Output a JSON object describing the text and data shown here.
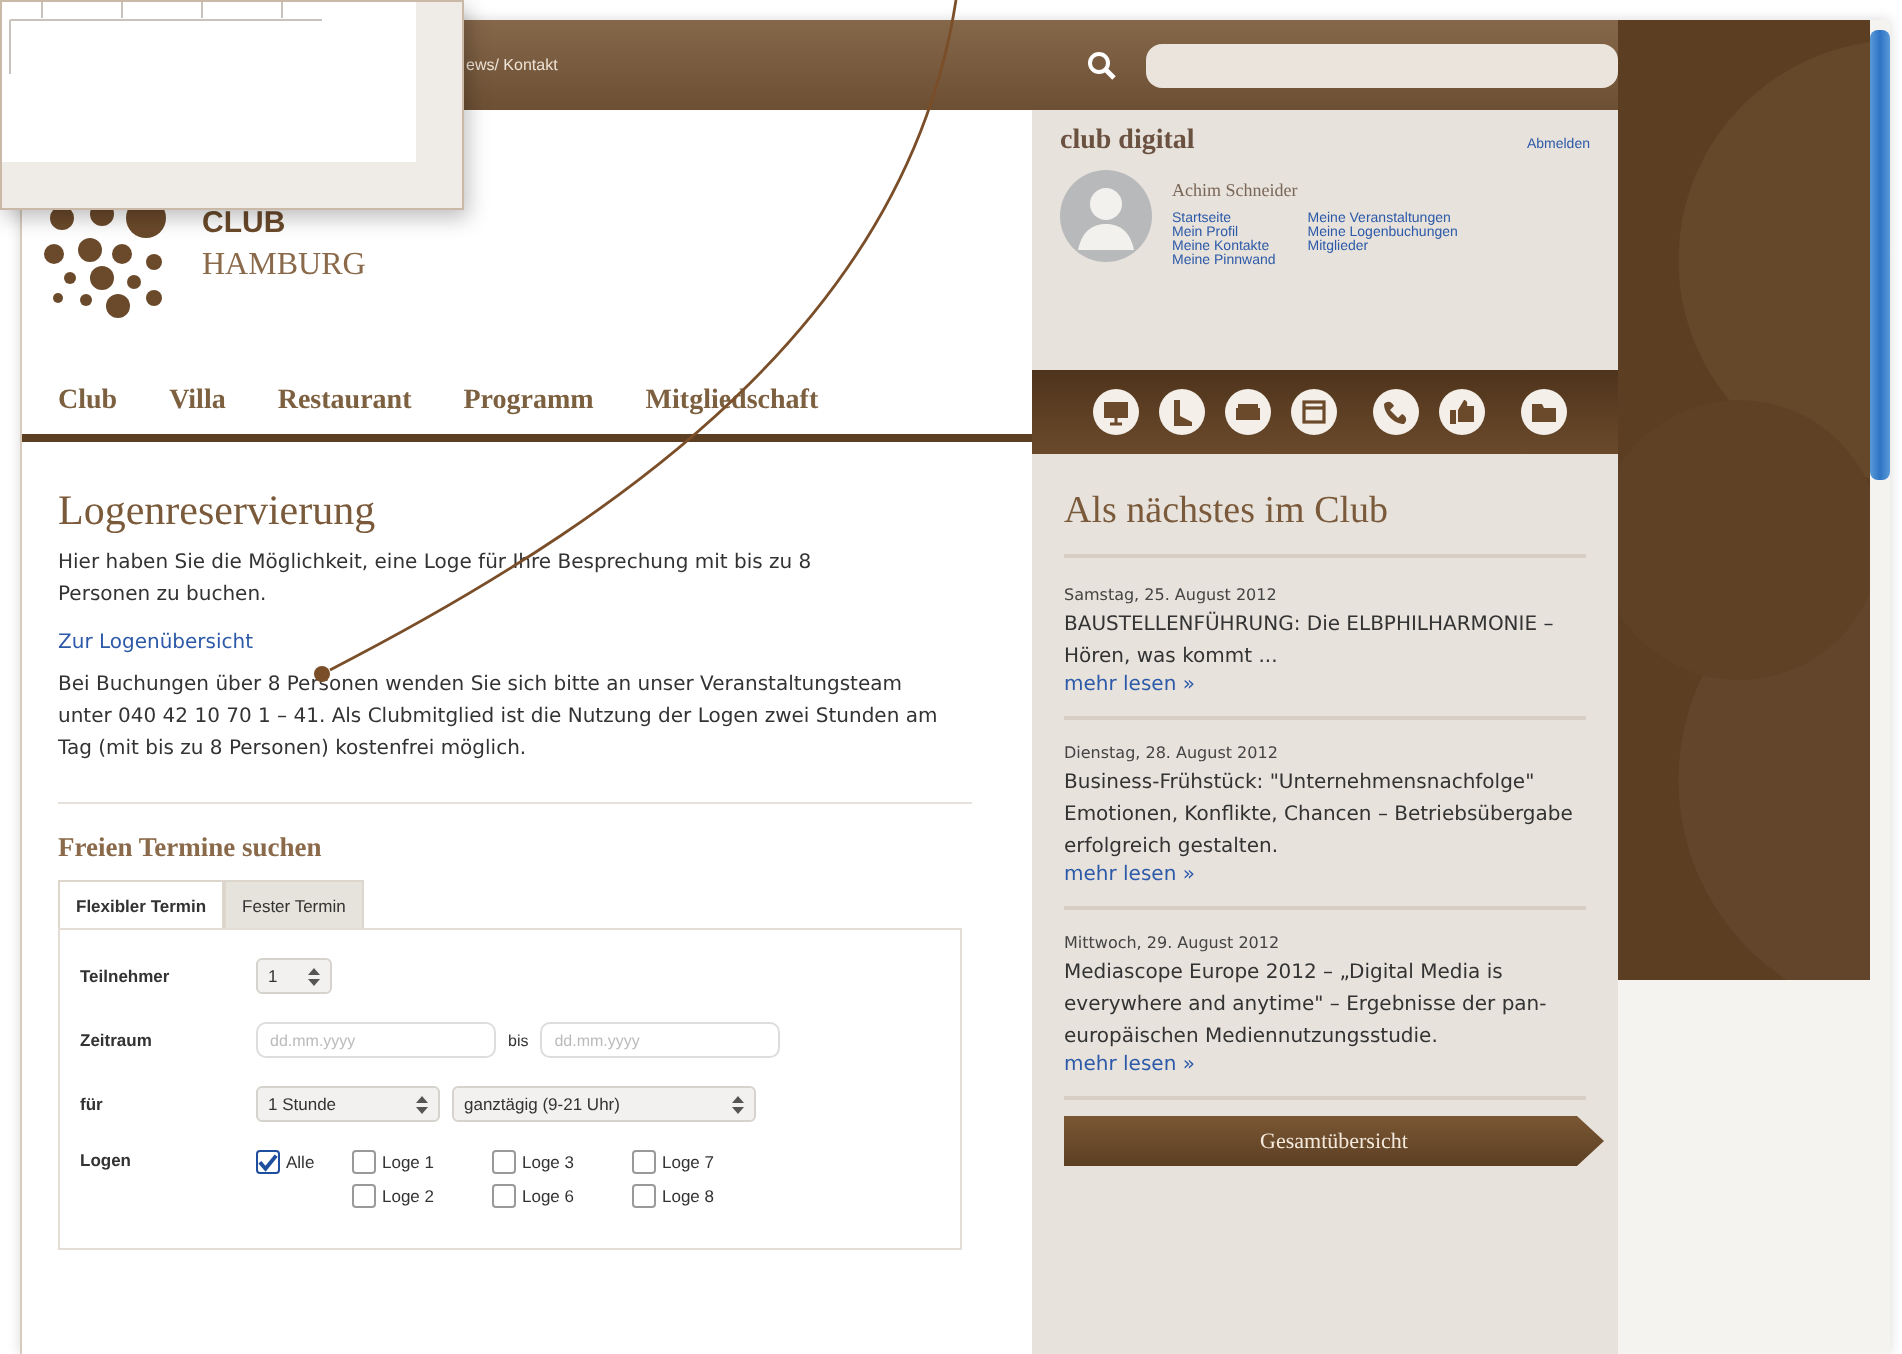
{
  "top_bar": {
    "breadcrumb": "ews/ Kontakt"
  },
  "logo": {
    "line_1": "CLUB",
    "line_2": "HAMBURG"
  },
  "nav": [
    "Club",
    "Villa",
    "Restaurant",
    "Programm",
    "Mitgliedschaft"
  ],
  "main": {
    "title": "Logenreservierung",
    "intro": "Hier haben Sie die Möglichkeit, eine Loge für Ihre Besprechung mit bis zu 8 Personen zu buchen.",
    "link": "Zur Logenübersicht",
    "body": "Bei Buchungen über 8 Personen wenden Sie sich bitte an unser Veranstaltungsteam unter 040 42 10 70 1 – 41. Als Clubmitglied ist die Nutzung der Logen zwei Stunden am Tag (mit bis zu 8 Personen) kostenfrei möglich.",
    "search_title": "Freien Termine suchen",
    "tabs": [
      {
        "label": "Flexibler Termin",
        "selected": true
      },
      {
        "label": "Fester Termin",
        "selected": false
      }
    ],
    "form": {
      "participants": {
        "label": "Teilnehmer",
        "value": "1"
      },
      "period": {
        "label": "Zeitraum",
        "from_placeholder": "dd.mm.yyyy",
        "separator": "bis",
        "to_placeholder": "dd.mm.yyyy"
      },
      "duration": {
        "label": "für",
        "value": "1 Stunde",
        "time_value": "ganztägig (9-21 Uhr)"
      },
      "boxes": {
        "label": "Logen",
        "options": [
          {
            "label": "Alle",
            "checked": true
          },
          {
            "label": "Loge 1",
            "checked": false
          },
          {
            "label": "Loge 3",
            "checked": false
          },
          {
            "label": "Loge 7",
            "checked": false
          },
          {
            "label": "Loge 2",
            "checked": false
          },
          {
            "label": "Loge 6",
            "checked": false
          },
          {
            "label": "Loge 8",
            "checked": false
          }
        ]
      }
    }
  },
  "club_digital": {
    "title": "club digital",
    "logout": "Abmelden",
    "user": "Achim Schneider",
    "links": [
      "Startseite",
      "Mein Profil",
      "Meine Kontakte",
      "Meine Pinnwand",
      "Meine Veranstaltungen",
      "Meine Logenbuchungen",
      "Mitglieder"
    ]
  },
  "events": {
    "title": "Als nächstes im Club",
    "items": [
      {
        "date": "Samstag, 25. August 2012",
        "text": "BAUSTELLENFÜHRUNG: Die ELBPHILHARMONIE – Hören, was kommt ...",
        "more": "mehr lesen »"
      },
      {
        "date": "Dienstag, 28. August 2012",
        "text": "Business-Frühstück: \"Unternehmensnachfolge\" Emotionen, Konflikte, Chancen – Betriebsübergabe erfolgreich gestalten.",
        "more": "mehr lesen »"
      },
      {
        "date": "Mittwoch, 29. August 2012",
        "text": "Mediascope Europe 2012 – „Digital Media is everywhere and anytime\" – Ergebnisse der pan-europäischen Mediennutzungsstudie.",
        "more": "mehr lesen »"
      }
    ],
    "button": "Gesamtübersicht"
  }
}
